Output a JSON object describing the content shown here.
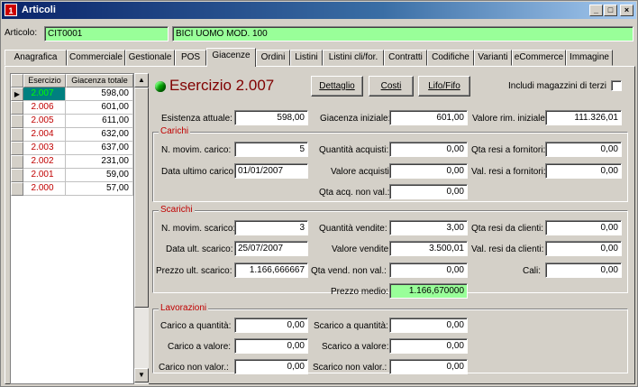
{
  "window": {
    "title": "Articoli",
    "app_icon": "1",
    "minimize": "_",
    "maximize": "□",
    "close": "×"
  },
  "article": {
    "label": "Articolo:",
    "code": "CIT0001",
    "description": "BICI UOMO MOD. 100"
  },
  "tabs": [
    "Anagrafica",
    "Commerciale",
    "Gestionale",
    "POS",
    "Giacenze",
    "Ordini",
    "Listini",
    "Listini cli/for.",
    "Contratti",
    "Codifiche",
    "Varianti",
    "eCommerce",
    "Immagine"
  ],
  "active_tab": "Giacenze",
  "grid": {
    "headers": [
      "Esercizio",
      "Giacenza totale"
    ],
    "rows": [
      {
        "year": "2.007",
        "total": "598,00"
      },
      {
        "year": "2.006",
        "total": "601,00"
      },
      {
        "year": "2.005",
        "total": "611,00"
      },
      {
        "year": "2.004",
        "total": "632,00"
      },
      {
        "year": "2.003",
        "total": "637,00"
      },
      {
        "year": "2.002",
        "total": "231,00"
      },
      {
        "year": "2.001",
        "total": "59,00"
      },
      {
        "year": "2.000",
        "total": "57,00"
      }
    ]
  },
  "esercizio": {
    "title": "Esercizio 2.007",
    "indicator_color": "#00a000"
  },
  "buttons": {
    "dettaglio": "Dettaglio",
    "costi": "Costi",
    "lifo": "Lifo/Fifo"
  },
  "includi": "Includi magazzini di terzi",
  "top": {
    "esistenza_label": "Esistenza attuale:",
    "esistenza": "598,00",
    "giacenza_label": "Giacenza iniziale:",
    "giacenza": "601,00",
    "valore_label": "Valore rim. iniziale:",
    "valore": "111.326,01"
  },
  "carichi": {
    "title": "Carichi",
    "n_label": "N. movim. carico:",
    "n": "5",
    "data_label": "Data ultimo carico:",
    "data": "01/01/2007",
    "qa_label": "Quantità acquisti:",
    "qa": "0,00",
    "va_label": "Valore acquisti:",
    "va": "0,00",
    "qanv_label": "Qta acq. non val.:",
    "qanv": "0,00",
    "qrf_label": "Qta resi a fornitori:",
    "qrf": "0,00",
    "vrf_label": "Val. resi a fornitori:",
    "vrf": "0,00"
  },
  "scarichi": {
    "title": "Scarichi",
    "n_label": "N. movim. scarico:",
    "n": "3",
    "data_label": "Data ult. scarico:",
    "data": "25/07/2007",
    "prezzo_label": "Prezzo ult. scarico:",
    "prezzo": "1.166,666667",
    "qv_label": "Quantità vendite:",
    "qv": "3,00",
    "vv_label": "Valore vendite:",
    "vv": "3.500,01",
    "qvnv_label": "Qta vend. non val.:",
    "qvnv": "0,00",
    "pm_label": "Prezzo medio:",
    "pm": "1.166,670000",
    "qrc_label": "Qta resi da clienti:",
    "qrc": "0,00",
    "vrc_label": "Val. resi da clienti:",
    "vrc": "0,00",
    "cali_label": "Cali:",
    "cali": "0,00"
  },
  "lavorazioni": {
    "title": "Lavorazioni",
    "cq_label": "Carico a quantità:",
    "cq": "0,00",
    "cv_label": "Carico a valore:",
    "cv": "0,00",
    "cnv_label": "Carico non valor.:",
    "cnv": "0,00",
    "sq_label": "Scarico a quantità:",
    "sq": "0,00",
    "sv_label": "Scarico a valore:",
    "sv": "0,00",
    "snv_label": "Scarico non valor.:",
    "snv": "0,00"
  }
}
